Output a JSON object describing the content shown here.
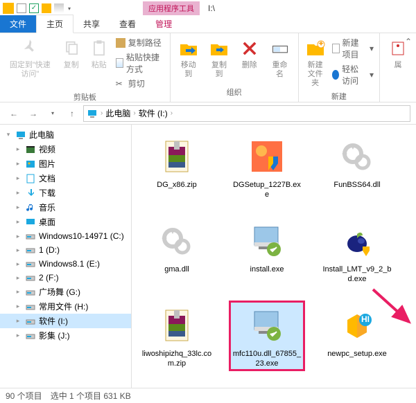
{
  "titlebar": {
    "app_tools": "应用程序工具",
    "drive": "I:\\"
  },
  "tabs": {
    "file": "文件",
    "home": "主页",
    "share": "共享",
    "view": "查看",
    "manage": "管理"
  },
  "ribbon": {
    "pin": {
      "label": "固定到\"快速访问\""
    },
    "copy": {
      "label": "复制"
    },
    "paste": {
      "label": "粘贴"
    },
    "copy_path": "复制路径",
    "paste_shortcut": "粘贴快捷方式",
    "cut": "剪切",
    "group_clipboard": "剪贴板",
    "move_to": "移动到",
    "copy_to": "复制到",
    "delete": "删除",
    "rename": "重命名",
    "group_organize": "组织",
    "new_folder": "新建\n文件夹",
    "new_item": "新建项目",
    "easy_access": "轻松访问",
    "group_new": "新建",
    "properties": "属"
  },
  "breadcrumb": {
    "pc": "此电脑",
    "drive": "软件 (I:)"
  },
  "tree": [
    {
      "label": "此电脑",
      "icon": "pc",
      "exp": "▾",
      "indent": 0
    },
    {
      "label": "视频",
      "icon": "video",
      "indent": 1
    },
    {
      "label": "图片",
      "icon": "pictures",
      "indent": 1
    },
    {
      "label": "文档",
      "icon": "documents",
      "indent": 1
    },
    {
      "label": "下载",
      "icon": "downloads",
      "indent": 1
    },
    {
      "label": "音乐",
      "icon": "music",
      "indent": 1
    },
    {
      "label": "桌面",
      "icon": "desktop",
      "indent": 1
    },
    {
      "label": "Windows10-14971 (C:)",
      "icon": "drive",
      "indent": 1
    },
    {
      "label": "1 (D:)",
      "icon": "drive",
      "indent": 1
    },
    {
      "label": "Windows8.1 (E:)",
      "icon": "drive",
      "indent": 1
    },
    {
      "label": "2 (F:)",
      "icon": "drive",
      "indent": 1
    },
    {
      "label": "广场舞 (G:)",
      "icon": "drive",
      "indent": 1
    },
    {
      "label": "常用文件 (H:)",
      "icon": "drive",
      "indent": 1
    },
    {
      "label": "软件  (I:)",
      "icon": "drive",
      "indent": 1,
      "selected": true
    },
    {
      "label": "影集 (J:)",
      "icon": "drive",
      "indent": 1
    }
  ],
  "files": [
    {
      "name": "DG_x86.zip",
      "type": "zip"
    },
    {
      "name": "DGSetup_1227B.exe",
      "type": "exe-shield"
    },
    {
      "name": "FunBSS64.dll",
      "type": "dll"
    },
    {
      "name": "gma.dll",
      "type": "dll"
    },
    {
      "name": "install.exe",
      "type": "exe-install"
    },
    {
      "name": "Install_LMT_v9_2_bd.exe",
      "type": "exe-fruit"
    },
    {
      "name": "liwoshipizhq_33lc.com.zip",
      "type": "zip"
    },
    {
      "name": "mfc110u.dll_67855_23.exe",
      "type": "exe-install",
      "selected": true
    },
    {
      "name": "newpc_setup.exe",
      "type": "exe-box"
    }
  ],
  "status": {
    "count": "90 个项目",
    "selection": "选中 1 个项目  631 KB"
  }
}
